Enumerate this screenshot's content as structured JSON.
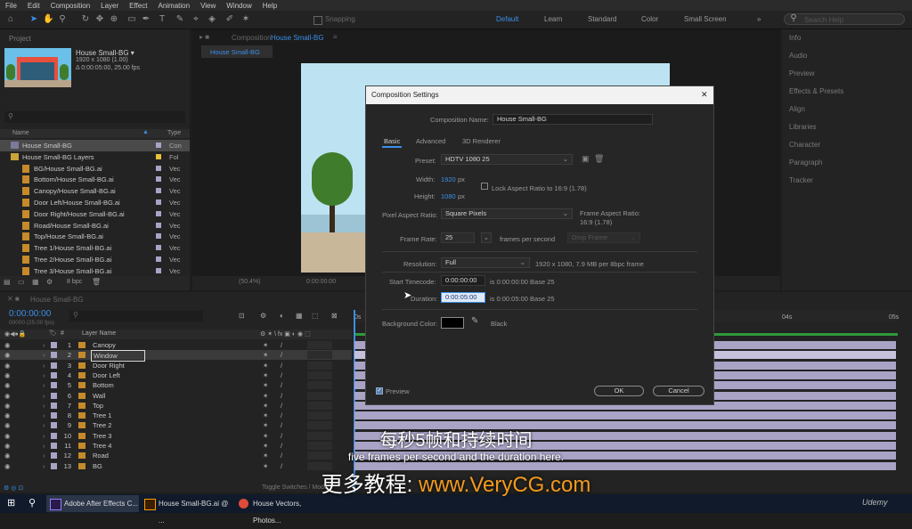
{
  "menu": [
    "File",
    "Edit",
    "Composition",
    "Layer",
    "Effect",
    "Animation",
    "View",
    "Window",
    "Help"
  ],
  "toolbar": {
    "snapping_label": "Snapping",
    "workspaces": [
      "Default",
      "Learn",
      "Standard",
      "Color",
      "Small Screen"
    ],
    "search_placeholder": "Search Help"
  },
  "project": {
    "tab": "Project",
    "comp_name": "House Small-BG ▾",
    "comp_res": "1920 x 1080 (1.00)",
    "comp_dur": "Δ 0:00:05:00, 25.00 fps",
    "col_name": "Name",
    "col_type": "Type",
    "items": [
      {
        "name": "House Small-BG",
        "type": "Con",
        "color": "#a9a3c6"
      },
      {
        "name": "House Small-BG Layers",
        "type": "Fol",
        "color": "#e8c23a"
      },
      {
        "name": "BG/House Small-BG.ai",
        "type": "Vec",
        "color": "#a9a3c6"
      },
      {
        "name": "Bottom/House Small-BG.ai",
        "type": "Vec",
        "color": "#a9a3c6"
      },
      {
        "name": "Canopy/House Small-BG.ai",
        "type": "Vec",
        "color": "#a9a3c6"
      },
      {
        "name": "Door Left/House Small-BG.ai",
        "type": "Vec",
        "color": "#a9a3c6"
      },
      {
        "name": "Door Right/House Small-BG.ai",
        "type": "Vec",
        "color": "#a9a3c6"
      },
      {
        "name": "Road/House Small-BG.ai",
        "type": "Vec",
        "color": "#a9a3c6"
      },
      {
        "name": "Top/House Small-BG.ai",
        "type": "Vec",
        "color": "#a9a3c6"
      },
      {
        "name": "Tree 1/House Small-BG.ai",
        "type": "Vec",
        "color": "#a9a3c6"
      },
      {
        "name": "Tree 2/House Small-BG.ai",
        "type": "Vec",
        "color": "#a9a3c6"
      },
      {
        "name": "Tree 3/House Small-BG.ai",
        "type": "Vec",
        "color": "#a9a3c6"
      }
    ],
    "bpc": "8 bpc"
  },
  "viewer": {
    "tab_prefix": "Composition",
    "tab_name": "House Small-BG",
    "comp_tab": "House Small-BG",
    "zoom": "(50.4%)",
    "timecode": "0:00:00:00"
  },
  "right_panels": [
    "Info",
    "Audio",
    "Preview",
    "Effects & Presets",
    "Align",
    "Libraries",
    "Character",
    "Paragraph",
    "Tracker"
  ],
  "timeline": {
    "tab": "House Small-BG",
    "current_time": "0:00:00:00",
    "frame_info": "00000 (25.00 fps)",
    "col_layer_name": "Layer Name",
    "ruler": [
      "0s",
      "04s",
      "05s"
    ],
    "toggle_label": "Toggle Switches / Modes",
    "layers": [
      {
        "num": "1",
        "name": "Canopy"
      },
      {
        "num": "2",
        "name": "Window"
      },
      {
        "num": "3",
        "name": "Door Right"
      },
      {
        "num": "4",
        "name": "Door Left"
      },
      {
        "num": "5",
        "name": "Bottom"
      },
      {
        "num": "6",
        "name": "Wall"
      },
      {
        "num": "7",
        "name": "Top"
      },
      {
        "num": "8",
        "name": "Tree 1"
      },
      {
        "num": "9",
        "name": "Tree 2"
      },
      {
        "num": "10",
        "name": "Tree 3"
      },
      {
        "num": "11",
        "name": "Tree 4"
      },
      {
        "num": "12",
        "name": "Road"
      },
      {
        "num": "13",
        "name": "BG"
      }
    ]
  },
  "dialog": {
    "title": "Composition Settings",
    "close": "✕",
    "comp_name_label": "Composition Name:",
    "comp_name_value": "House Small-BG",
    "tabs": [
      "Basic",
      "Advanced",
      "3D Renderer"
    ],
    "preset_label": "Preset:",
    "preset_value": "HDTV 1080 25",
    "width_label": "Width:",
    "width_value": "1920",
    "height_label": "Height:",
    "height_value": "1080",
    "px": "px",
    "lock_label": "Lock Aspect Ratio to 16:9 (1.78)",
    "par_label": "Pixel Aspect Ratio:",
    "par_value": "Square Pixels",
    "far_label": "Frame Aspect Ratio:",
    "far_value": "16:9 (1.78)",
    "fr_label": "Frame Rate:",
    "fr_value": "25",
    "fps_label": "frames per second",
    "drop_frame": "Drop Frame",
    "res_label": "Resolution:",
    "res_value": "Full",
    "res_info": "1920 x 1080, 7.9 MB per 8bpc frame",
    "start_label": "Start Timecode:",
    "start_value": "0:00:00:00",
    "start_info": "is 0:00:00:00  Base 25",
    "dur_label": "Duration:",
    "dur_value": "0:00:05:00",
    "dur_info": "is 0:00:05:00  Base 25",
    "bg_label": "Background Color:",
    "bg_name": "Black",
    "preview_label": "Preview",
    "ok": "OK",
    "cancel": "Cancel"
  },
  "subtitles": {
    "chinese": "每秒5帧和持续时间",
    "english": "five frames per second and the duration here.",
    "promo_prefix": "更多教程: ",
    "promo_url": "www.VeryCG.com"
  },
  "taskbar": {
    "apps": [
      "Adobe After Effects C...",
      "House Small-BG.ai @ ...",
      "House Vectors, Photos..."
    ]
  },
  "watermark": "Udemy",
  "colors": {
    "accent": "#3b8fe8",
    "label_lavender": "#a9a3c6",
    "folder_yellow": "#e8c23a",
    "ai_orange": "#c58a2a",
    "promo_orange": "#f29a1e"
  }
}
